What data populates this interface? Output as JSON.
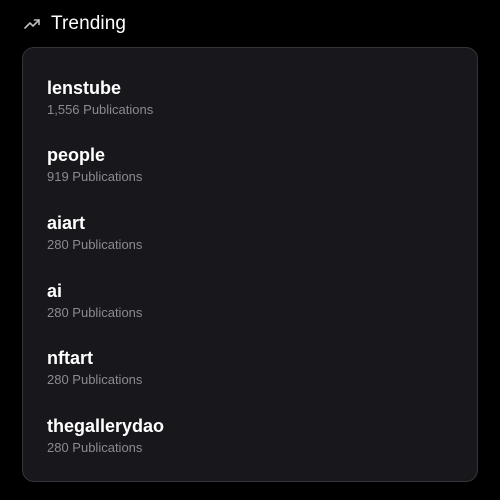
{
  "header": {
    "icon": "trending-up-icon",
    "title": "Trending"
  },
  "colors": {
    "background": "#000000",
    "card_background": "#18171c",
    "card_border": "#35343a",
    "primary_text": "#ffffff",
    "secondary_text": "#8b8a91"
  },
  "trending": {
    "items": [
      {
        "name": "lenstube",
        "count": "1,556 Publications"
      },
      {
        "name": "people",
        "count": "919 Publications"
      },
      {
        "name": "aiart",
        "count": "280 Publications"
      },
      {
        "name": "ai",
        "count": "280 Publications"
      },
      {
        "name": "nftart",
        "count": "280 Publications"
      },
      {
        "name": "thegallerydao",
        "count": "280 Publications"
      }
    ]
  }
}
